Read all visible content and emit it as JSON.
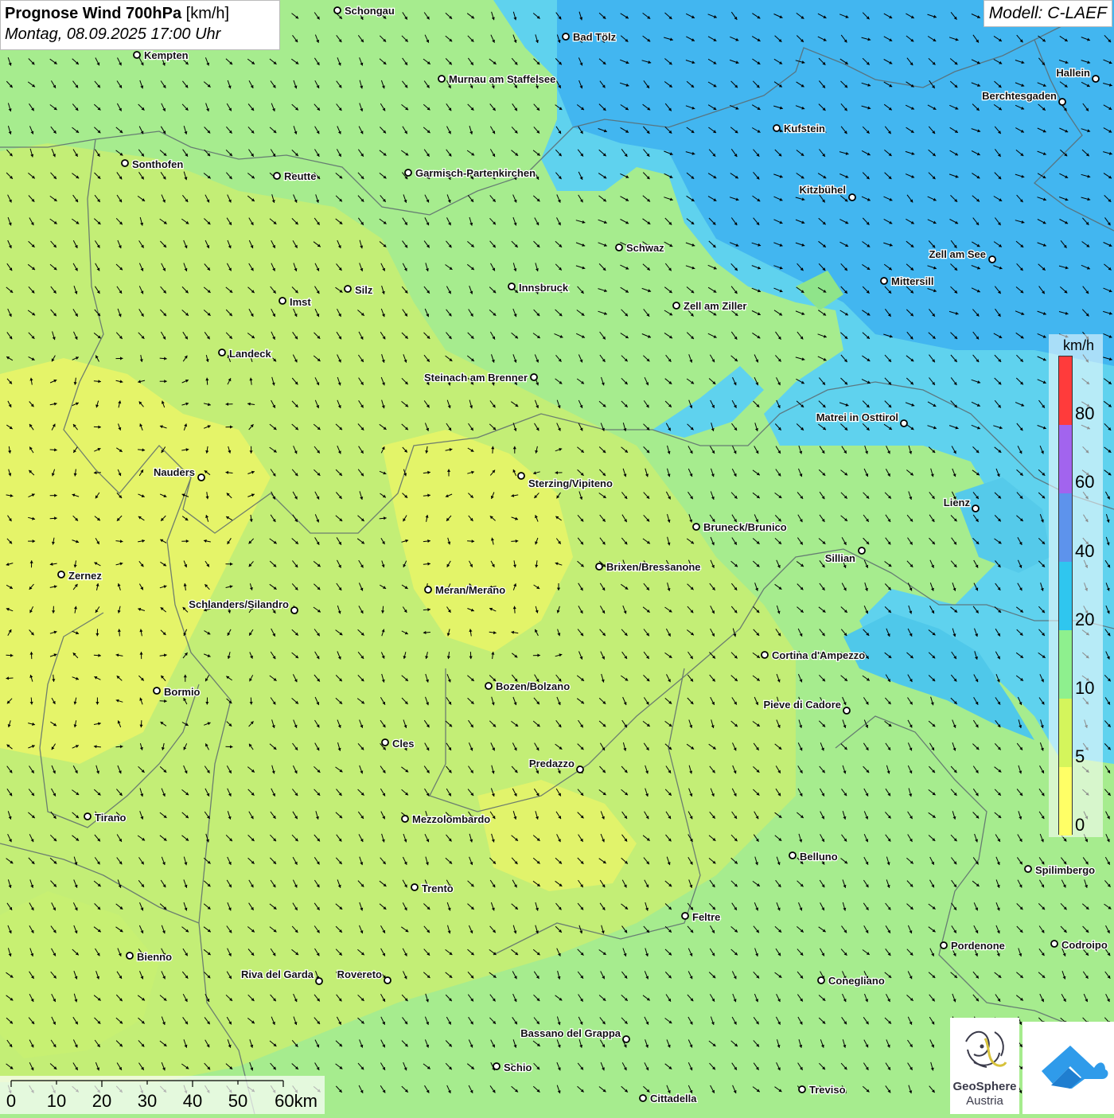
{
  "header": {
    "title_bold": "Prognose Wind 700hPa",
    "title_unit": "[km/h]",
    "datetime": "Montag, 08.09.2025 17:00 Uhr",
    "model": "Modell: C-LAEF"
  },
  "legend": {
    "unit": "km/h",
    "labels": [
      "80",
      "60",
      "40",
      "20",
      "10",
      "5",
      "0"
    ],
    "colors": [
      "#ff3b3b",
      "#a264ee",
      "#5d93ec",
      "#2fc6ef",
      "#8ef08e",
      "#d4f55c",
      "#ffff66"
    ]
  },
  "scale_bar": {
    "labels": [
      "0",
      "10",
      "20",
      "30",
      "40",
      "50",
      "60km"
    ]
  },
  "logos": {
    "geosphere_line1": "GeoSphere",
    "geosphere_line2": "Austria"
  },
  "cities": [
    {
      "name": "Schongau"
    },
    {
      "name": "Bad Tölz"
    },
    {
      "name": "Kempten"
    },
    {
      "name": "Murnau am Staffelsee"
    },
    {
      "name": "Hallein"
    },
    {
      "name": "Berchtesgaden"
    },
    {
      "name": "Kufstein"
    },
    {
      "name": "Sonthofen"
    },
    {
      "name": "Reutte"
    },
    {
      "name": "Garmisch-Partenkirchen"
    },
    {
      "name": "Kitzbühel"
    },
    {
      "name": "Schwaz"
    },
    {
      "name": "Zell am See"
    },
    {
      "name": "Mittersill"
    },
    {
      "name": "Innsbruck"
    },
    {
      "name": "Silz"
    },
    {
      "name": "Imst"
    },
    {
      "name": "Zell am Ziller"
    },
    {
      "name": "Landeck"
    },
    {
      "name": "Steinach am Brenner"
    },
    {
      "name": "Matrei in Osttirol"
    },
    {
      "name": "Nauders"
    },
    {
      "name": "Sterzing/Vipiteno"
    },
    {
      "name": "Lienz"
    },
    {
      "name": "Bruneck/Brunico"
    },
    {
      "name": "Sillian"
    },
    {
      "name": "Zernez"
    },
    {
      "name": "Brixen/Bressanone"
    },
    {
      "name": "Meran/Merano"
    },
    {
      "name": "Schlanders/Silandro"
    },
    {
      "name": "Cortina d'Ampezzo"
    },
    {
      "name": "Bozen/Bolzano"
    },
    {
      "name": "Bormio"
    },
    {
      "name": "Pieve di Cadore"
    },
    {
      "name": "Cles"
    },
    {
      "name": "Predazzo"
    },
    {
      "name": "Tirano"
    },
    {
      "name": "Mezzolombardo"
    },
    {
      "name": "Belluno"
    },
    {
      "name": "Spilimbergo"
    },
    {
      "name": "Trento"
    },
    {
      "name": "Feltre"
    },
    {
      "name": "Pordenone"
    },
    {
      "name": "Codroipo"
    },
    {
      "name": "Bienno"
    },
    {
      "name": "Riva del Garda"
    },
    {
      "name": "Rovereto"
    },
    {
      "name": "Conegliano"
    },
    {
      "name": "Bassano del Grappa"
    },
    {
      "name": "Schio"
    },
    {
      "name": "Treviso"
    },
    {
      "name": "Cittadella"
    }
  ]
}
